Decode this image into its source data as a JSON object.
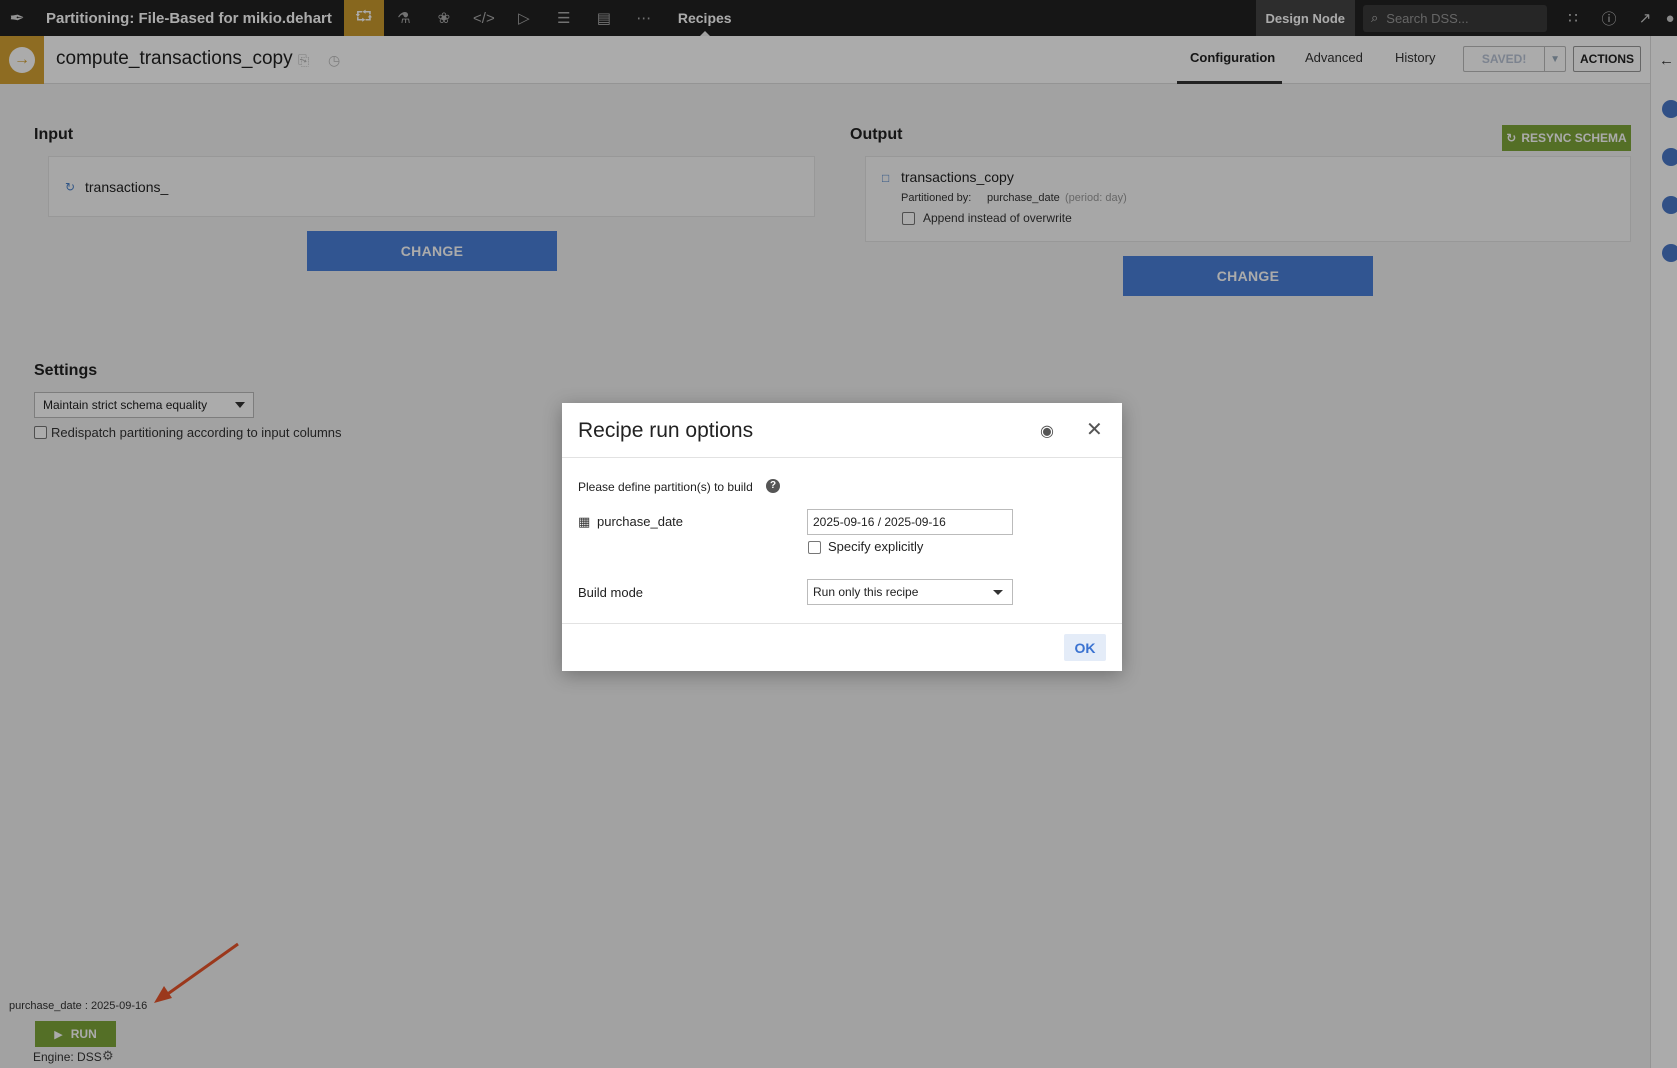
{
  "topnav": {
    "project_title": "Partitioning: File-Based for mikio.dehart",
    "icons": [
      "flow-icon",
      "lab-icon",
      "datasets-icon",
      "code-icon",
      "jobs-icon",
      "dashboards-icon",
      "wiki-icon",
      "more-icon"
    ],
    "recipes_label": "Recipes",
    "design_node_label": "Design Node",
    "search_placeholder": "Search DSS...",
    "accent_color": "#c99a2e"
  },
  "recipe_bar": {
    "recipe_name": "compute_transactions_copy",
    "tabs": [
      "Configuration",
      "Advanced",
      "History"
    ],
    "active_tab": "Configuration",
    "saved_label": "SAVED!",
    "actions_label": "ACTIONS"
  },
  "input": {
    "title": "Input",
    "dataset": "transactions_",
    "change_label": "CHANGE"
  },
  "output": {
    "title": "Output",
    "resync_label": "RESYNC SCHEMA",
    "dataset": "transactions_copy",
    "partitioned_by_label": "Partitioned by:",
    "partition_column": "purchase_date",
    "partition_period": "(period: day)",
    "append_label": "Append instead of overwrite",
    "change_label": "CHANGE"
  },
  "settings": {
    "title": "Settings",
    "schema_mode": "Maintain strict schema equality",
    "redispatch_label": "Redispatch partitioning according to input columns"
  },
  "bottom": {
    "partition_info": "purchase_date : 2025-09-16",
    "run_label": "RUN",
    "engine_label": "Engine: DSS"
  },
  "modal": {
    "title": "Recipe run options",
    "instruction": "Please define partition(s) to build",
    "partition_field_label": "purchase_date",
    "partition_value": "2025-09-16 / 2025-09-16",
    "specify_explicitly_label": "Specify explicitly",
    "build_mode_label": "Build mode",
    "build_mode_value": "Run only this recipe",
    "ok_label": "OK"
  }
}
